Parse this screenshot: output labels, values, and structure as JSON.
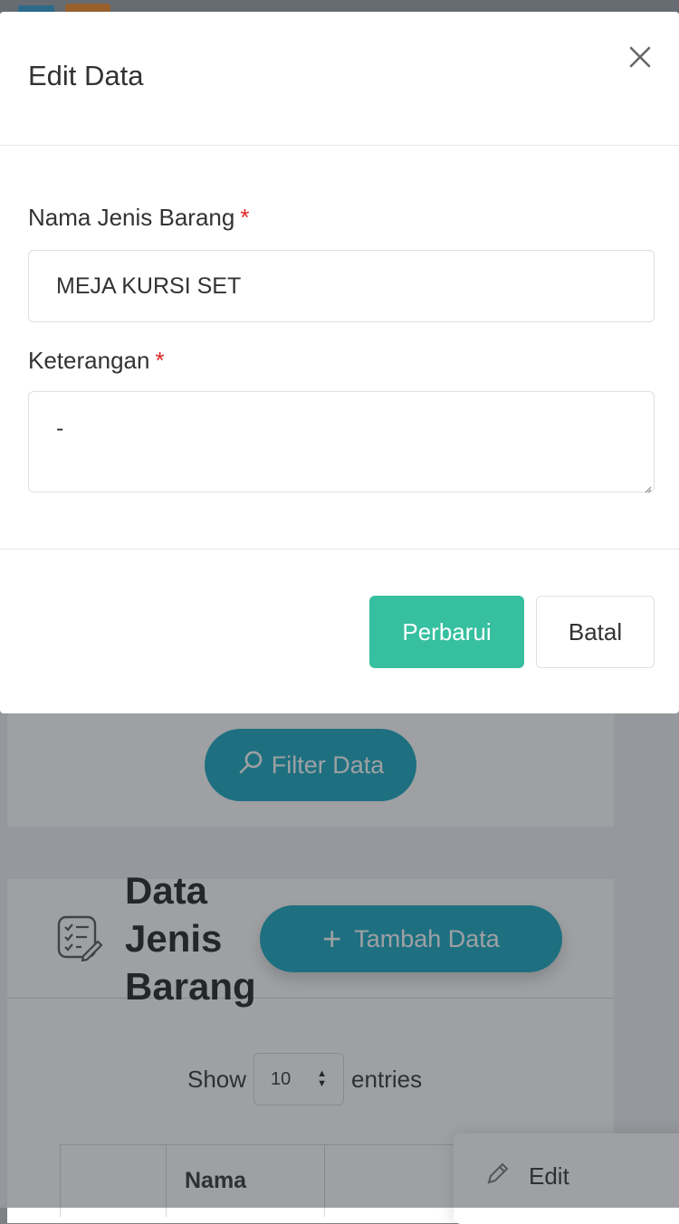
{
  "modal": {
    "title": "Edit Data",
    "close_icon": "close-icon",
    "fields": [
      {
        "label": "Nama Jenis Barang",
        "required_mark": "*",
        "value": "MEJA KURSI SET"
      },
      {
        "label": "Keterangan",
        "required_mark": "*",
        "value": "-"
      }
    ],
    "primary_button": "Perbarui",
    "secondary_button": "Batal"
  },
  "background": {
    "filter_button": {
      "icon": "search-icon",
      "label": "Filter Data"
    },
    "section_icon": "checklist-edit-icon",
    "section_title": "Data Jenis Barang",
    "add_button": {
      "icon": "plus-icon",
      "label": "Tambah Data"
    },
    "show_label": "Show",
    "entries_value": "10",
    "entries_label": "entries",
    "table_column": "Nama",
    "action_menu": {
      "icon": "pencil-icon",
      "label": "Edit"
    }
  },
  "colors": {
    "primary_teal": "#36c0a0",
    "filter_blue": "#17a8bf",
    "required_red": "#e02424"
  }
}
